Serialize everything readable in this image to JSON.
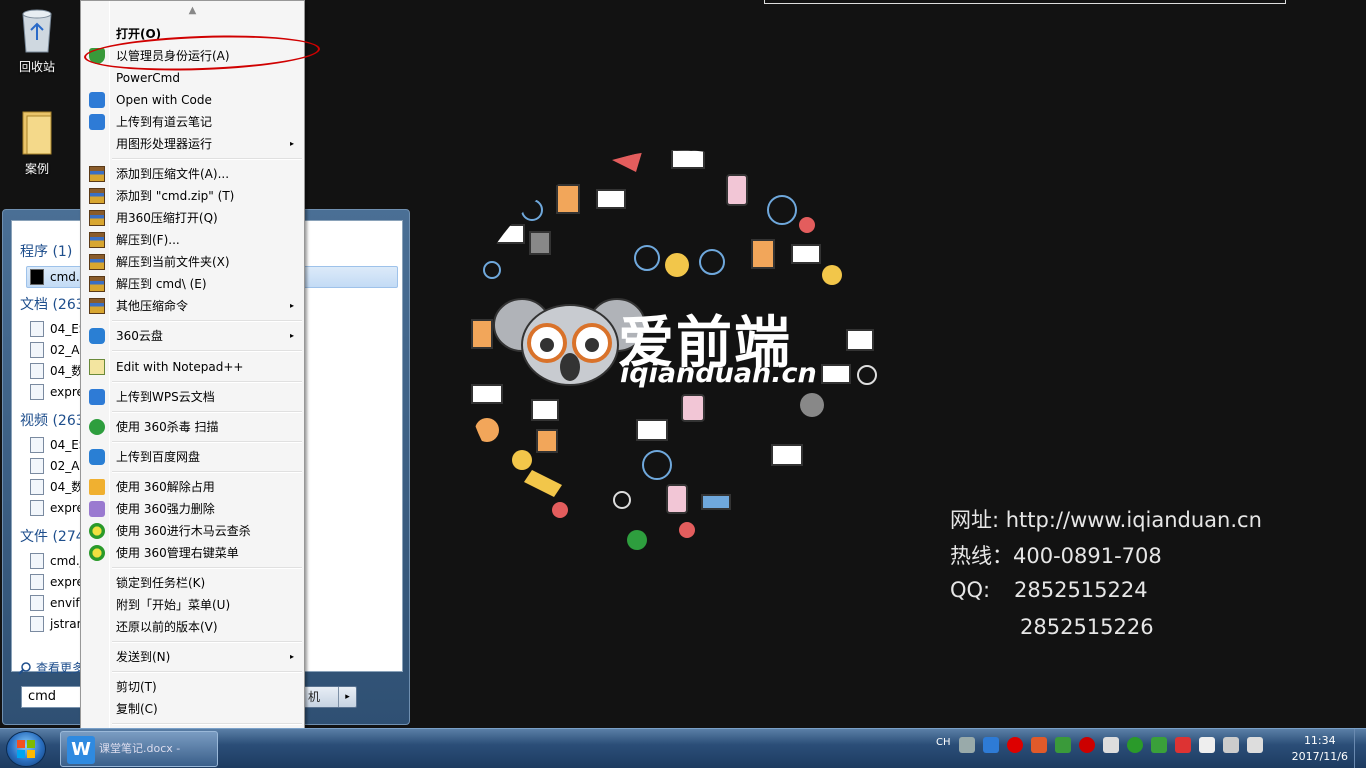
{
  "desktop": {
    "icons": [
      {
        "label": "回收站"
      },
      {
        "label": "案例"
      }
    ]
  },
  "brand": {
    "title": "爱前端",
    "url": "iqianduan.cn"
  },
  "contact": {
    "website": "网址:  http://www.iqianduan.cn",
    "hotline": "热线：400-0891-708",
    "qq_label": "QQ:",
    "qq1": "2852515224",
    "qq2": "2852515226"
  },
  "start_menu": {
    "sections": [
      {
        "title": "程序 (1)",
        "items": [
          "cmd.e"
        ]
      },
      {
        "title": "文档 (263",
        "items": [
          "04_ES",
          "02_AN",
          "04_数",
          "expre"
        ]
      },
      {
        "title": "视频 (263",
        "items": [
          "04_ES",
          "02_AN",
          "04_数",
          "expre"
        ]
      },
      {
        "title": "文件 (274",
        "items": [
          "cmd.j",
          "expre",
          "envify",
          "jstran"
        ]
      }
    ],
    "see_more": "查看更多",
    "search_value": "cmd",
    "shutdown_label": "机",
    "shutdown_arrow": "▸"
  },
  "context_menu": {
    "items": [
      {
        "label": "打开(O)",
        "bold": true
      },
      {
        "label": "以管理员身份运行(A)"
      },
      {
        "label": "PowerCmd"
      },
      {
        "label": "Open with Code"
      },
      {
        "label": "上传到有道云笔记"
      },
      {
        "label": "用图形处理器运行",
        "submenu": true
      },
      {
        "label": "添加到压缩文件(A)..."
      },
      {
        "label": "添加到 \"cmd.zip\" (T)"
      },
      {
        "label": "用360压缩打开(Q)"
      },
      {
        "label": "解压到(F)..."
      },
      {
        "label": "解压到当前文件夹(X)"
      },
      {
        "label": "解压到 cmd\\ (E)"
      },
      {
        "label": "其他压缩命令",
        "submenu": true
      },
      {
        "label": "360云盘",
        "submenu": true
      },
      {
        "label": "Edit with Notepad++"
      },
      {
        "label": "上传到WPS云文档"
      },
      {
        "label": "使用 360杀毒 扫描"
      },
      {
        "label": "上传到百度网盘"
      },
      {
        "label": "使用 360解除占用"
      },
      {
        "label": "使用 360强力删除"
      },
      {
        "label": "使用 360进行木马云查杀"
      },
      {
        "label": "使用 360管理右键菜单"
      },
      {
        "label": "锁定到任务栏(K)"
      },
      {
        "label": "附到「开始」菜单(U)"
      },
      {
        "label": "还原以前的版本(V)"
      },
      {
        "label": "发送到(N)",
        "submenu": true
      },
      {
        "label": "剪切(T)"
      },
      {
        "label": "复制(C)"
      }
    ],
    "submenu_arrow": "▸",
    "scroll_up": "▲",
    "scroll_down": "▼"
  },
  "taskbar": {
    "task_label": "课堂笔记.docx -",
    "task_icon": "W",
    "lang": "CH",
    "time": "11:34",
    "date": "2017/11/6"
  }
}
